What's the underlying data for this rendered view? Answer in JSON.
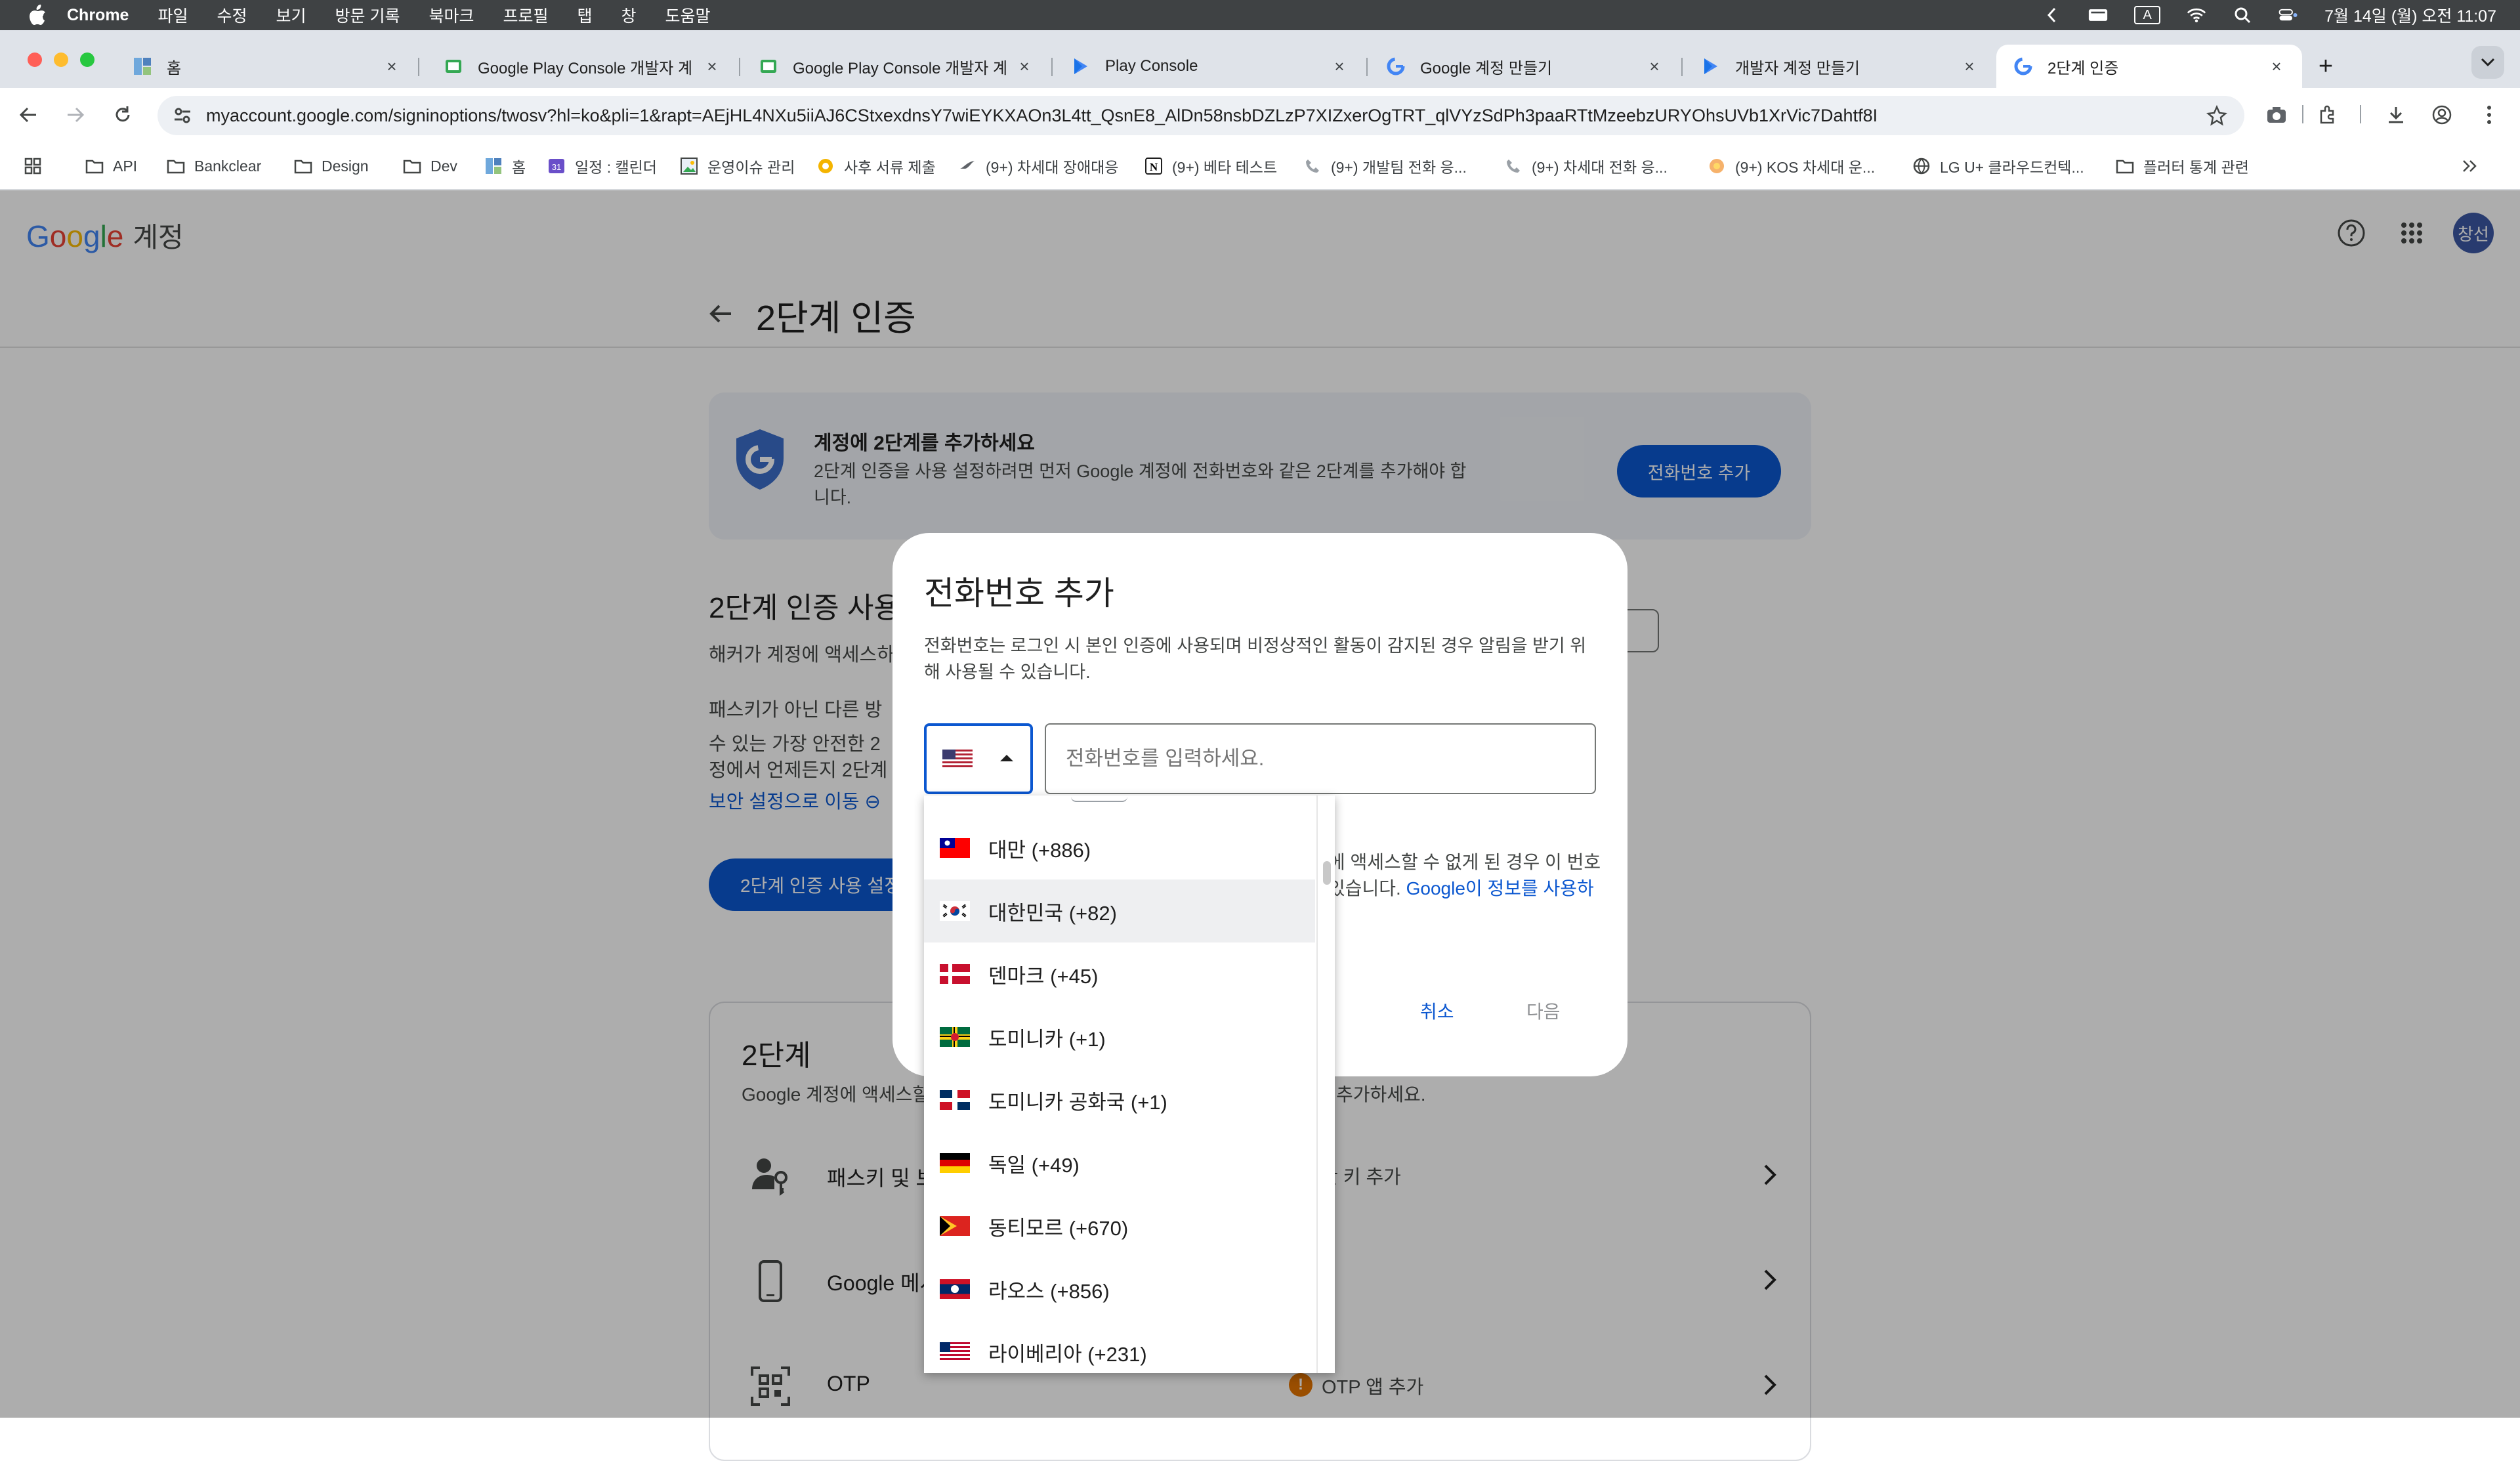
{
  "menubar": {
    "app": "Chrome",
    "items": [
      "파일",
      "수정",
      "보기",
      "방문 기록",
      "북마크",
      "프로필",
      "탭",
      "창",
      "도움말"
    ],
    "clock": "7월 14일 (월) 오전 11:07",
    "input_indicator": "A"
  },
  "tabs": [
    {
      "title": "홈",
      "icon": "notion-board-icon"
    },
    {
      "title": "Google Play Console 개발자 계",
      "icon": "play-console-icon"
    },
    {
      "title": "Google Play Console 개발자 계",
      "icon": "play-console-icon"
    },
    {
      "title": "Play Console",
      "icon": "play-icon"
    },
    {
      "title": "Google 계정 만들기",
      "icon": "google-icon"
    },
    {
      "title": "개발자 계정 만들기",
      "icon": "play-icon"
    },
    {
      "title": "2단계 인증",
      "icon": "google-icon",
      "active": true
    }
  ],
  "toolbar": {
    "url": "myaccount.google.com/signinoptions/twosv?hl=ko&pli=1&rapt=AEjHL4NXu5iiAJ6CStxexdnsY7wiEYKXAOn3L4tt_QsnE8_AlDn58nsbDZLzP7XIZxerOgTRT_qlVYzSdPh3paaRTtMzeebzURYOhsUVb1XrVic7Dahtf8I"
  },
  "bookmarks": [
    {
      "label": "",
      "icon": "apps-grid-icon"
    },
    {
      "label": "API",
      "icon": "folder-icon"
    },
    {
      "label": "Bankclear",
      "icon": "folder-icon"
    },
    {
      "label": "Design",
      "icon": "folder-icon"
    },
    {
      "label": "Dev",
      "icon": "folder-icon"
    },
    {
      "label": "홈",
      "icon": "notion-board-icon"
    },
    {
      "label": "일정 : 캘린더",
      "icon": "calendar-icon"
    },
    {
      "label": "운영이슈 관리",
      "icon": "image-icon"
    },
    {
      "label": "사후 서류 제출",
      "icon": "gear-yellow-icon"
    },
    {
      "label": "(9+) 차세대 장애대응",
      "icon": "bird-icon"
    },
    {
      "label": "(9+) 베타 테스트",
      "icon": "notion-icon"
    },
    {
      "label": "(9+) 개발팀 전화 응...",
      "icon": "phone-icon"
    },
    {
      "label": "(9+) 차세대 전화 응...",
      "icon": "phone-icon"
    },
    {
      "label": "(9+) KOS 차세대 운...",
      "icon": "flower-icon"
    },
    {
      "label": "LG U+ 클라우드컨텍...",
      "icon": "globe-icon"
    },
    {
      "label": "플러터 통계 관련",
      "icon": "folder-icon"
    }
  ],
  "header": {
    "logo": [
      "G",
      "o",
      "o",
      "g",
      "l",
      "e"
    ],
    "account_label": "계정",
    "avatar_text": "창선",
    "page_title": "2단계 인증"
  },
  "banner": {
    "title": "계정에 2단계를 추가하세요",
    "desc": "2단계 인증을 사용 설정하려면 먼저 Google 계정에 전화번호와 같은 2단계를 추가해야 합니다.",
    "button": "전화번호 추가"
  },
  "section": {
    "title": "2단계 인증 사용",
    "line1": "해커가 계정에 액세스하",
    "line2": "패스키가 아닌 다른 방",
    "line3": "수 있는 가장 안전한 2",
    "line4": "정에서 언제든지 2단계",
    "link": "보안 설정으로 이동 ⊖",
    "button": "2단계 인증 사용 설정"
  },
  "card": {
    "title": "2단계",
    "desc_left": "Google 계정에 액세스할",
    "desc_right": "추가하세요.",
    "rows": [
      {
        "label": "패스키 및 보",
        "sub": "안 키 추가",
        "icon": "passkey-icon"
      },
      {
        "label": "Google 메시",
        "sub": "",
        "icon": "phone-device-icon"
      },
      {
        "label": "OTP",
        "sub": "OTP 앱 추가",
        "icon": "qr-icon"
      }
    ]
  },
  "dialog": {
    "title": "전화번호 추가",
    "desc": "전화번호는 로그인 시 본인 인증에 사용되며 비정상적인 활동이 감지된 경우 알림을 받기 위해 사용될 수 있습니다.",
    "phone_placeholder": "전화번호를 입력하세요.",
    "info_line1": "에 액세스할 수 없게 된 경우 이 번호",
    "info_line2_a": "있습니다. ",
    "info_line2_link": "Google이 정보를 사용하",
    "cancel": "취소",
    "next": "다음",
    "selected_country_flag": "us-flag-icon"
  },
  "dropdown": {
    "items": [
      {
        "label": "대만 (+886)",
        "flag": "tw"
      },
      {
        "label": "대한민국 (+82)",
        "flag": "kr",
        "highlighted": true
      },
      {
        "label": "덴마크 (+45)",
        "flag": "dk"
      },
      {
        "label": "도미니카 (+1)",
        "flag": "dm"
      },
      {
        "label": "도미니카 공화국 (+1)",
        "flag": "do"
      },
      {
        "label": "독일 (+49)",
        "flag": "de"
      },
      {
        "label": "동티모르 (+670)",
        "flag": "tl"
      },
      {
        "label": "라오스 (+856)",
        "flag": "la"
      },
      {
        "label": "라이베리아 (+231)",
        "flag": "lr"
      }
    ]
  },
  "colors": {
    "accent": "#0b57d0",
    "google_blue": "#4285f4"
  }
}
